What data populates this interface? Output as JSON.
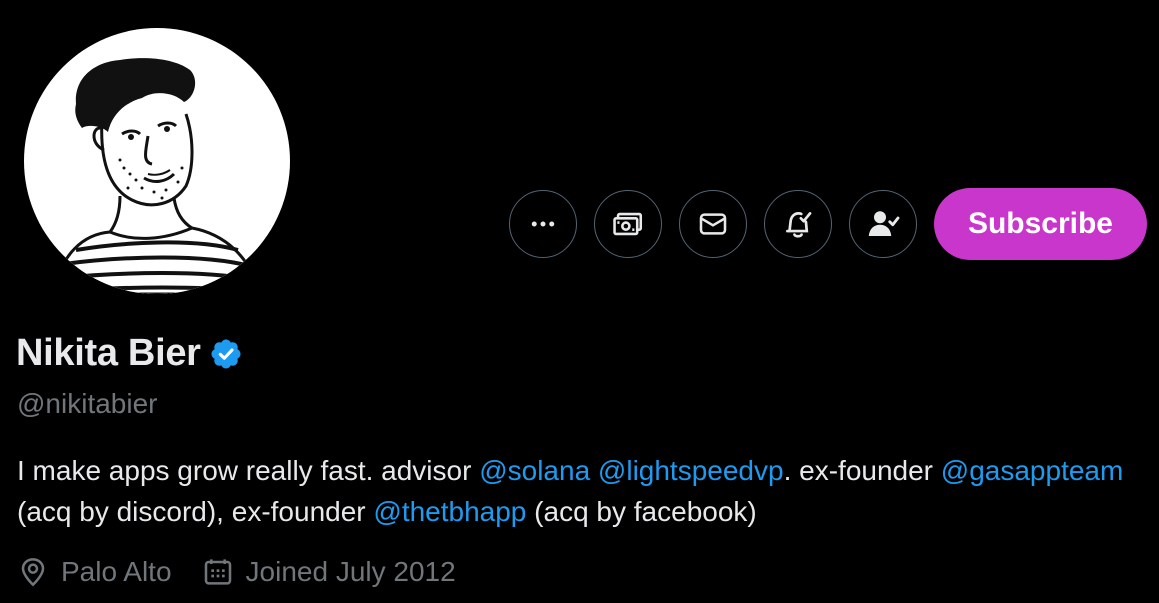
{
  "profile": {
    "name": "Nikita Bier",
    "handle": "@nikitabier",
    "verified": true,
    "avatar": "illustrated-portrait-avatar"
  },
  "actions": {
    "more_icon": "ellipsis-icon",
    "tip_icon": "money-icon",
    "message_icon": "envelope-icon",
    "notify_icon": "bell-icon",
    "follow_icon": "person-check-icon",
    "subscribe_label": "Subscribe"
  },
  "bio": {
    "part1": "I make apps grow really fast. advisor ",
    "mention1": "@solana",
    "space1": " ",
    "mention2": "@lightspeedvp",
    "part2": ". ex-founder ",
    "mention3": "@gasappteam",
    "part3": " (acq by discord), ex-founder ",
    "mention4": "@thetbhapp",
    "part4": " (acq by facebook)"
  },
  "meta": {
    "location_icon": "location-pin-icon",
    "location": "Palo Alto",
    "joined_icon": "calendar-icon",
    "joined": "Joined July 2012"
  },
  "colors": {
    "background": "#000000",
    "text": "#e7e9ea",
    "secondary": "#71767b",
    "accent": "#1d9bf0",
    "subscribe": "#c936cc",
    "border": "#536471"
  }
}
